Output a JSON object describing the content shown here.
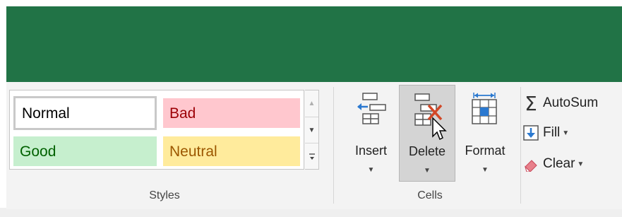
{
  "styles_group": {
    "label": "Styles",
    "items": [
      {
        "label": "Normal",
        "text_color": "#000000",
        "fill": "#ffffff"
      },
      {
        "label": "Bad",
        "text_color": "#9c0006",
        "fill": "#ffc7ce"
      },
      {
        "label": "Good",
        "text_color": "#006100",
        "fill": "#c6efce"
      },
      {
        "label": "Neutral",
        "text_color": "#9c5700",
        "fill": "#ffeb9c"
      }
    ],
    "scroll": {
      "up_icon": "triangle-up-icon",
      "down_icon": "triangle-down-icon",
      "more_icon": "more-icon"
    }
  },
  "cells_group": {
    "label": "Cells",
    "buttons": [
      {
        "label": "Insert",
        "icon": "insert-cells-icon"
      },
      {
        "label": "Delete",
        "icon": "delete-cells-icon",
        "state": "hovered"
      },
      {
        "label": "Format",
        "icon": "format-cells-icon"
      }
    ]
  },
  "editing_group": {
    "items": [
      {
        "label": "AutoSum",
        "icon": "sigma-icon"
      },
      {
        "label": "Fill",
        "icon": "fill-down-icon"
      },
      {
        "label": "Clear",
        "icon": "eraser-icon"
      }
    ]
  },
  "colors": {
    "title_bar": "#217346",
    "ribbon": "#f3f3f3"
  }
}
